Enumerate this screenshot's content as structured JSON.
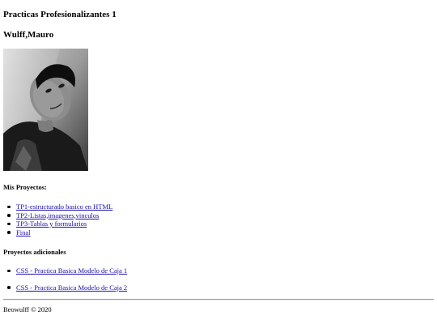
{
  "header": {
    "title": "Practicas Profesionalizantes 1",
    "author": "Wulff,Mauro"
  },
  "profile": {
    "photo_icon": "profile-photo"
  },
  "projects": {
    "heading": "Mis Proyectos:",
    "items": [
      {
        "label": "TP1-estructurado basico en HTML"
      },
      {
        "label": "TP2-Listas,imagenes,vinculos"
      },
      {
        "label": "TP3-Tablas y formularios"
      },
      {
        "label": "Final"
      }
    ]
  },
  "extra_projects": {
    "heading": "Proyectos adicionales",
    "items": [
      {
        "label": "CSS - Practica Basica Modelo de Caja 1"
      },
      {
        "label": "CSS - Practica Basica Modelo de Caja 2"
      }
    ]
  },
  "footer": {
    "text": "Beowulff © 2020"
  },
  "colors": {
    "link": "#1a0dab",
    "text": "#000000",
    "background": "#ffffff"
  }
}
